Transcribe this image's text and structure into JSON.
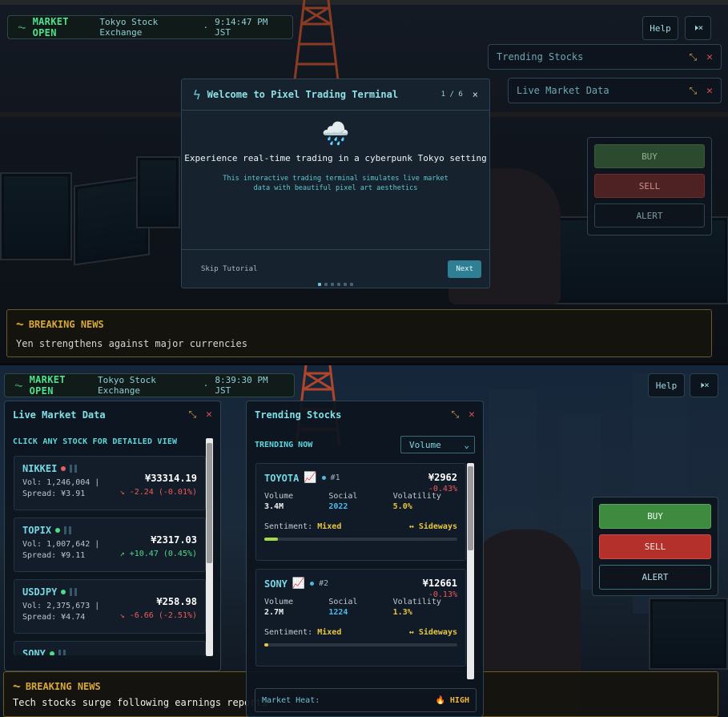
{
  "top": {
    "status": {
      "label": "MARKET OPEN",
      "exchange": "Tokyo Stock Exchange",
      "sep": "·",
      "time": "9:14:47 PM JST"
    },
    "help_label": "Help",
    "sound_label": "🕨×",
    "minimized": [
      {
        "title": "Trending Stocks"
      },
      {
        "title": "Live Market Data"
      }
    ],
    "trade": {
      "buy": "BUY",
      "sell": "SELL",
      "alert": "ALERT"
    },
    "news": {
      "heading": "BREAKING NEWS",
      "text": "Yen strengthens against major currencies"
    },
    "tutorial": {
      "title": "Welcome to Pixel Trading Terminal",
      "step": "1 / 6",
      "close": "×",
      "emoji": "🌧️",
      "headline": "Experience real-time trading in a cyberpunk Tokyo setting",
      "description": "This interactive trading terminal simulates live market data with beautiful pixel art aesthetics",
      "skip": "Skip Tutorial",
      "next": "Next",
      "active_step": 1,
      "total_steps": 6
    }
  },
  "bottom": {
    "status": {
      "label": "MARKET OPEN",
      "exchange": "Tokyo Stock Exchange",
      "sep": "·",
      "time": "8:39:30 PM JST"
    },
    "help_label": "Help",
    "sound_label": "🕨×",
    "trade": {
      "buy": "BUY",
      "sell": "SELL",
      "alert": "ALERT"
    },
    "news": {
      "heading": "BREAKING NEWS",
      "text": "Tech stocks surge following earnings reports"
    },
    "live_market": {
      "title": "Live Market Data",
      "hint": "CLICK ANY STOCK FOR DETAILED VIEW",
      "stocks": [
        {
          "symbol": "NIKKEI",
          "dot_color": "#e06262",
          "volume": "Vol: 1,246,004 |",
          "spread": "Spread: ¥3.91",
          "price": "¥33314.19",
          "change": "↘ -2.24 (-0.01%)",
          "direction": "down"
        },
        {
          "symbol": "TOPIX",
          "dot_color": "#4fdc86",
          "volume": "Vol: 1,007,642 |",
          "spread": "Spread: ¥9.11",
          "price": "¥2317.03",
          "change": "↗ +10.47 (0.45%)",
          "direction": "up"
        },
        {
          "symbol": "USDJPY",
          "dot_color": "#4fdc86",
          "volume": "Vol: 2,375,673 |",
          "spread": "Spread: ¥4.74",
          "price": "¥258.98",
          "change": "↘ -6.66 (-2.51%)",
          "direction": "down"
        },
        {
          "symbol": "SONY",
          "dot_color": "#4fdc86",
          "volume": "",
          "spread": "",
          "price": "",
          "change": "",
          "direction": "up"
        }
      ]
    },
    "trending": {
      "title": "Trending Stocks",
      "label": "TRENDING NOW",
      "sort": "Volume",
      "labels": {
        "volume": "Volume",
        "social": "Social",
        "volatility": "Volatility",
        "sentiment": "Sentiment:"
      },
      "cards": [
        {
          "symbol": "TOYOTA",
          "rank": "#1",
          "price": "¥2962",
          "change": "-0.43%",
          "volume": "3.4M",
          "social": "2022",
          "volatility": "5.0%",
          "sentiment": "Mixed",
          "trend": "↔ Sideways",
          "sentiment_level": 0.07
        },
        {
          "symbol": "SONY",
          "rank": "#2",
          "price": "¥12661",
          "change": "-0.13%",
          "volume": "2.7M",
          "social": "1224",
          "volatility": "1.3%",
          "sentiment": "Mixed",
          "trend": "↔ Sideways",
          "sentiment_level": 0.02
        }
      ],
      "heat_label": "Market Heat:",
      "heat_value": "🔥 HIGH"
    }
  },
  "colors": {
    "accent": "#6fd3d6",
    "up": "#4fdc86",
    "down": "#ef5a5a",
    "news": "#d8a83a",
    "buy": "#3e8a3f",
    "sell": "#b3302b"
  }
}
